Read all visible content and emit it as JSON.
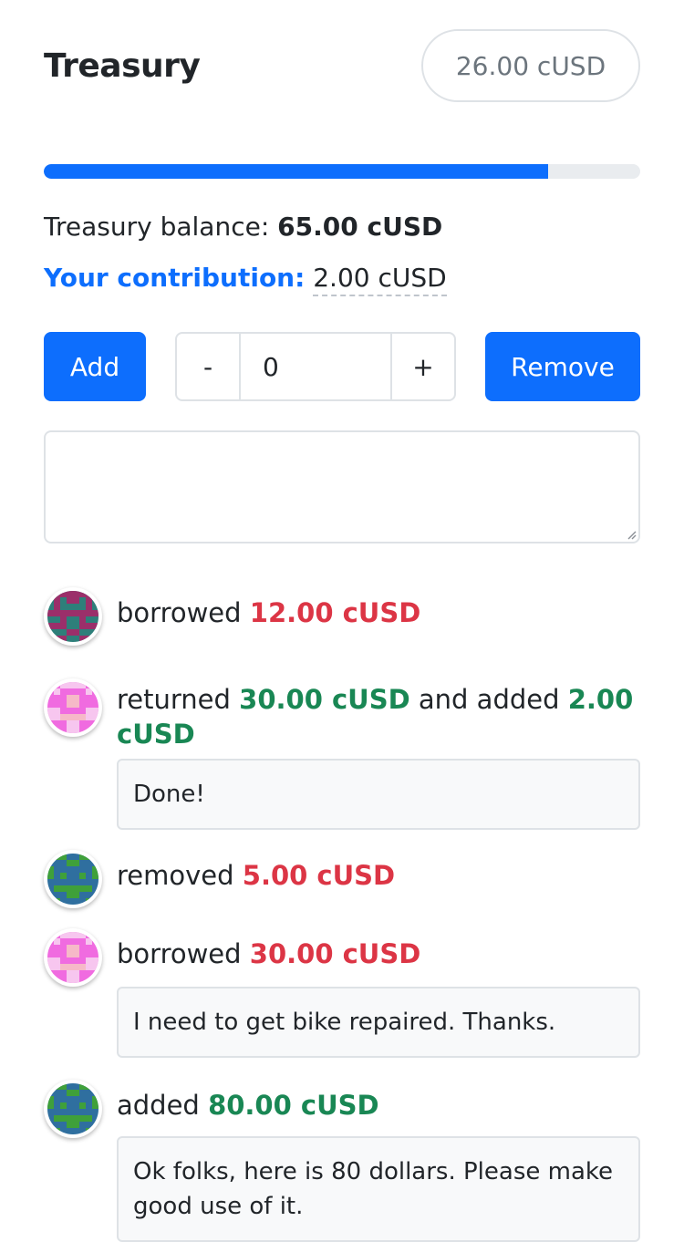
{
  "header": {
    "title": "Treasury",
    "pill_amount": "26.00 cUSD"
  },
  "treasury": {
    "progress_fraction": 0.845,
    "balance_label": "Treasury balance:",
    "balance_value": "65.00 cUSD",
    "contribution_label": "Your contribution:",
    "contribution_value": "2.00 cUSD"
  },
  "controls": {
    "add_label": "Add",
    "remove_label": "Remove",
    "minus_label": "-",
    "plus_label": "+",
    "amount_value": "0",
    "note_value": ""
  },
  "colors": {
    "primary": "#0d6efd",
    "negative": "#dc3545",
    "positive": "#198754"
  },
  "feed": [
    {
      "avatar": "avatar-magenta-teal-icon",
      "verb": "borrowed",
      "amount": "12.00 cUSD",
      "amount_kind": "out"
    },
    {
      "avatar": "avatar-pink-icon",
      "verb": "returned",
      "amount": "30.00 cUSD",
      "amount_kind": "in",
      "connector": "and added",
      "amount2": "2.00 cUSD",
      "note": "Done!"
    },
    {
      "avatar": "avatar-blue-green-icon",
      "verb": "removed",
      "amount": "5.00 cUSD",
      "amount_kind": "out"
    },
    {
      "avatar": "avatar-pink-icon",
      "verb": "borrowed",
      "amount": "30.00 cUSD",
      "amount_kind": "out",
      "note": "I need to get bike repaired. Thanks."
    },
    {
      "avatar": "avatar-blue-green-icon",
      "verb": "added",
      "amount": "80.00 cUSD",
      "amount_kind": "in",
      "note": "Ok folks, here is 80 dollars. Please make good use of it."
    }
  ]
}
